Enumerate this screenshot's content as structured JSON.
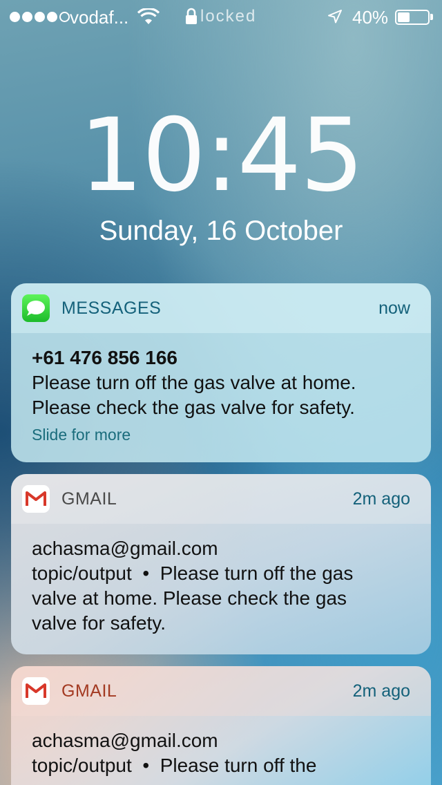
{
  "status_bar": {
    "carrier": "vodaf...",
    "lock_label": "locked",
    "battery_percent": "40%",
    "battery_level": 0.4
  },
  "lock_screen": {
    "time_h": "10",
    "time_colon": ":",
    "time_m": "45",
    "date": "Sunday, 16 October"
  },
  "notifications": [
    {
      "app": "MESSAGES",
      "time": "now",
      "sender": "+61 476 856 166",
      "line1": "Please turn off the gas valve at home.",
      "line2": "Please check the gas valve for safety.",
      "more": "Slide for more"
    },
    {
      "app": "GMAIL",
      "time": "2m ago",
      "sender": "achasma@gmail.com",
      "line1": "topic/output  •  Please turn off the gas",
      "line2": "valve at home. Please check the gas",
      "line3": "valve for safety."
    },
    {
      "app": "GMAIL",
      "time": "2m ago",
      "sender": "achasma@gmail.com",
      "line1": "topic/output  •  Please turn off the"
    }
  ]
}
